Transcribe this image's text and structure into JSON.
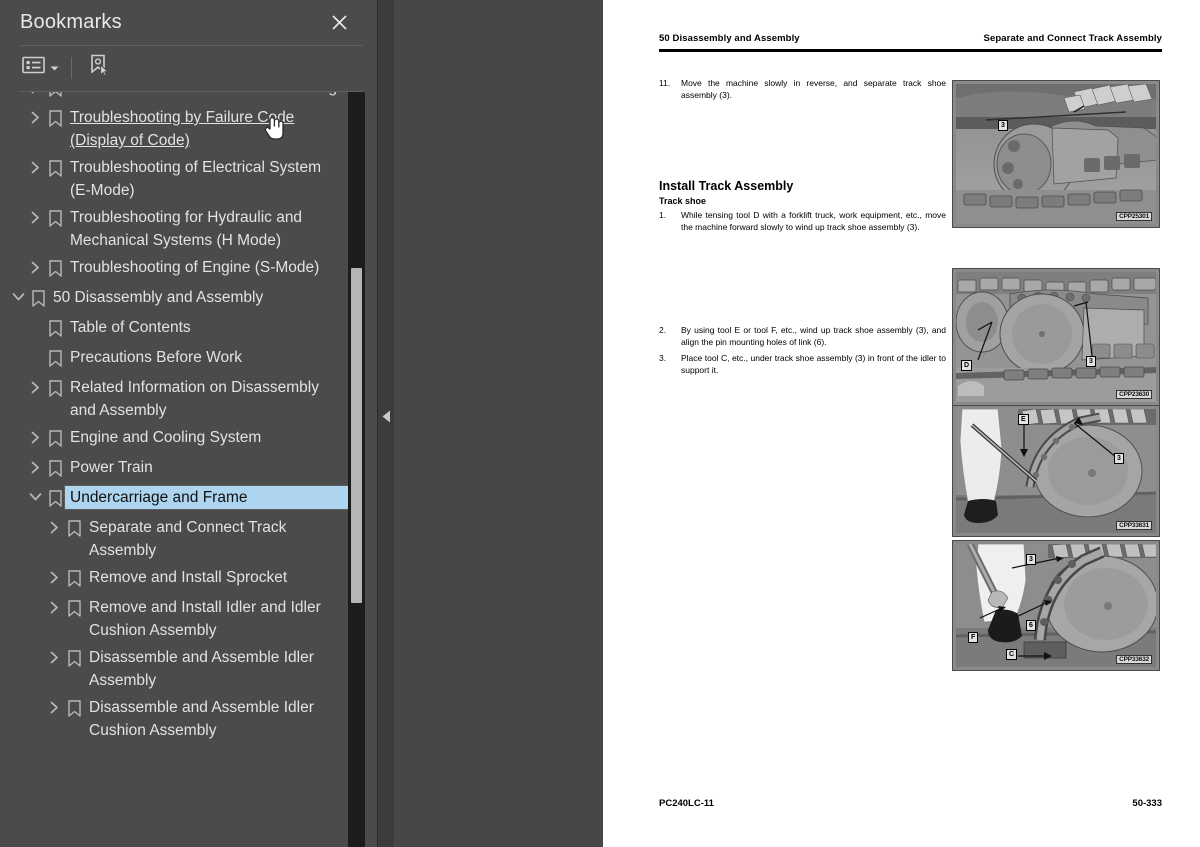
{
  "panel": {
    "title": "Bookmarks",
    "close_icon": "close-icon",
    "toolbar": {
      "list_options_icon": "list-options-icon",
      "dropdown_icon": "chevron-down-icon",
      "bookmark_cursor_icon": "bookmark-pointer-icon"
    },
    "selected_color": "#aed5ef",
    "background_color": "#4b4b4b"
  },
  "bookmarks": [
    {
      "label": "Related Information to Troubleshooting",
      "depth": 1,
      "arrow": "collapsed",
      "state": "clipped"
    },
    {
      "label": "Troubleshooting by Failure Code (Display of Code)",
      "depth": 1,
      "arrow": "collapsed",
      "state": "hovered"
    },
    {
      "label": "Troubleshooting of Electrical System (E-Mode)",
      "depth": 1,
      "arrow": "collapsed",
      "state": "normal"
    },
    {
      "label": "Troubleshooting for Hydraulic and Mechanical Systems (H Mode)",
      "depth": 1,
      "arrow": "collapsed",
      "state": "normal"
    },
    {
      "label": "Troubleshooting of Engine (S-Mode)",
      "depth": 1,
      "arrow": "collapsed",
      "state": "normal"
    },
    {
      "label": "50 Disassembly and Assembly",
      "depth": 0,
      "arrow": "expanded",
      "state": "normal"
    },
    {
      "label": "Table of Contents",
      "depth": 1,
      "arrow": "none",
      "state": "normal"
    },
    {
      "label": "Precautions Before Work",
      "depth": 1,
      "arrow": "none",
      "state": "normal"
    },
    {
      "label": "Related Information on Disassembly and Assembly",
      "depth": 1,
      "arrow": "collapsed",
      "state": "normal"
    },
    {
      "label": "Engine and Cooling System",
      "depth": 1,
      "arrow": "collapsed",
      "state": "normal"
    },
    {
      "label": "Power Train",
      "depth": 1,
      "arrow": "collapsed",
      "state": "normal"
    },
    {
      "label": "Undercarriage and Frame",
      "depth": 1,
      "arrow": "expanded",
      "state": "selected"
    },
    {
      "label": "Separate and Connect Track Assembly",
      "depth": 2,
      "arrow": "collapsed",
      "state": "normal"
    },
    {
      "label": "Remove and Install Sprocket",
      "depth": 2,
      "arrow": "collapsed",
      "state": "normal"
    },
    {
      "label": "Remove and Install Idler and Idler Cushion Assembly",
      "depth": 2,
      "arrow": "collapsed",
      "state": "normal"
    },
    {
      "label": "Disassemble and Assemble Idler Assembly",
      "depth": 2,
      "arrow": "collapsed",
      "state": "normal"
    },
    {
      "label": "Disassemble and Assemble Idler Cushion Assembly",
      "depth": 2,
      "arrow": "collapsed",
      "state": "normal"
    }
  ],
  "splitter": {
    "collapse_icon": "collapse-left-icon"
  },
  "document": {
    "header_left": "50 Disassembly and Assembly",
    "header_right": "Separate and Connect Track Assembly",
    "footer_left": "PC240LC-11",
    "footer_right": "50-333",
    "blocks": [
      {
        "type": "step",
        "num": "11.",
        "text": "Move the machine slowly in reverse, and separate track shoe assembly (3)."
      },
      {
        "type": "heading1",
        "text": "Install Track Assembly"
      },
      {
        "type": "heading2",
        "text": "Track shoe"
      },
      {
        "type": "step",
        "num": "1.",
        "text": "While tensing tool D with a forklift truck, work equipment, etc., move the machine forward slowly to wind up track shoe assembly (3)."
      },
      {
        "type": "step",
        "num": "2.",
        "text": "By using tool E or tool F, etc., wind up track shoe assembly (3), and align the pin mounting holes of link (6)."
      },
      {
        "type": "step",
        "num": "3.",
        "text": "Place tool C, etc., under track shoe assembly (3) in front of the idler to support it."
      }
    ],
    "figures": [
      {
        "code": "CPP25301",
        "callouts": [
          "3"
        ],
        "alt": "track-shoe-separated-photo"
      },
      {
        "code": "CPP23630",
        "callouts": [
          "D",
          "3"
        ],
        "alt": "winding-up-track-shoe-photo"
      },
      {
        "code": "CPP33631",
        "callouts": [
          "E",
          "3"
        ],
        "alt": "wind-up-with-tool-e-photo"
      },
      {
        "code": "CPP33632",
        "callouts": [
          "3",
          "6",
          "F",
          "C"
        ],
        "alt": "support-with-tool-c-photo"
      }
    ]
  },
  "cursor": {
    "type": "hand-pointer-cursor"
  }
}
